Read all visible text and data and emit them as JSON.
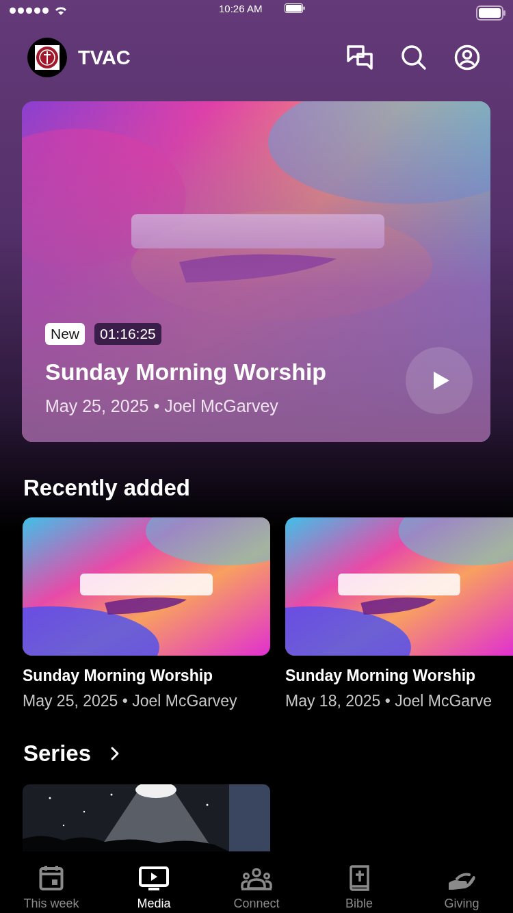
{
  "status_bar": {
    "time": "10:26 AM"
  },
  "header": {
    "title": "TVAC"
  },
  "hero": {
    "badge": "New",
    "duration": "01:16:25",
    "title": "Sunday Morning Worship",
    "meta": "May 25, 2025 • Joel McGarvey"
  },
  "recently_added": {
    "heading": "Recently added",
    "items": [
      {
        "title": "Sunday Morning Worship",
        "meta": "May 25, 2025 • Joel McGarvey"
      },
      {
        "title": "Sunday Morning Worship",
        "meta": "May 18, 2025 • Joel McGarve"
      }
    ]
  },
  "series": {
    "heading": "Series"
  },
  "tab_bar": [
    {
      "label": "This week",
      "selected": false
    },
    {
      "label": "Media",
      "selected": true
    },
    {
      "label": "Connect",
      "selected": false
    },
    {
      "label": "Bible",
      "selected": false
    },
    {
      "label": "Giving",
      "selected": false
    }
  ]
}
